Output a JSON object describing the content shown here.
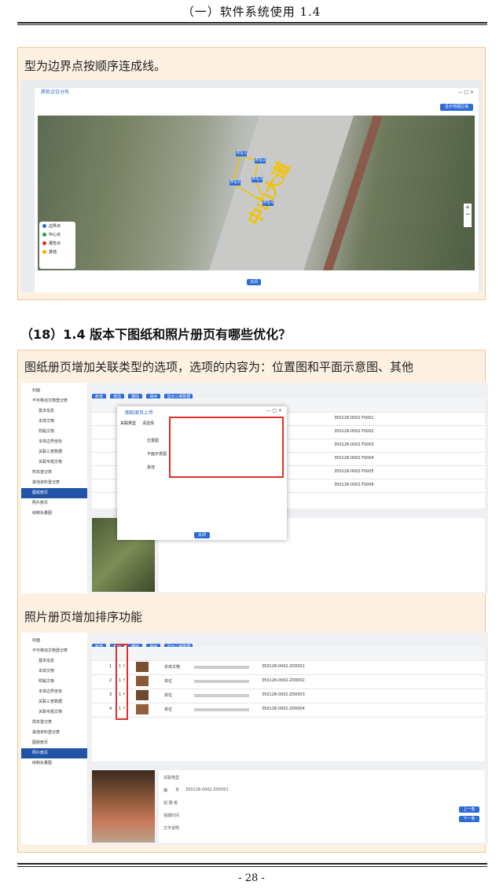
{
  "header": {
    "title": "（一）软件系统使用 1.4"
  },
  "panel1": {
    "text": "型为边界点按顺序连成线。",
    "dialog_title": "质检点位分布",
    "draw_button": "显示地图区域",
    "confirm_button": "关闭",
    "road_label": "中山大道",
    "points": [
      "界址1",
      "界址2",
      "界址3",
      "界址4",
      "界址5"
    ],
    "legend": [
      {
        "label": "边界点",
        "color": "#2d6bd6"
      },
      {
        "label": "中心点",
        "color": "#22a34a"
      },
      {
        "label": "报告点",
        "color": "#e0302a"
      },
      {
        "label": "其他",
        "color": "#e8b400"
      }
    ]
  },
  "section18": {
    "heading": "（18）1.4 版本下图纸和照片册页有哪些优化？"
  },
  "panel2": {
    "text": "图纸册页增加关联类型的选项，选项的内容为：位置图和平面示意图、其他",
    "toolbar": [
      "新增",
      "修改",
      "删除",
      "保存",
      "显示三维数据"
    ],
    "sidebar": [
      "封面",
      "不可移动文物登记表",
      "基本信息",
      "本体文物",
      "附属文物",
      "本体边界坐标",
      "关联三普数据",
      "关联专题文物",
      "附本登记表",
      "其他资料登记表",
      "图纸册页",
      "照片册页",
      "绘制矢量图"
    ],
    "dialog": {
      "title": "图纸册页上传",
      "field_label": "关联类型",
      "select_placeholder": "请选择",
      "options": [
        "位置图",
        "平面示意图",
        "其他"
      ],
      "close_button": "关闭"
    },
    "codes": [
      "350128-0002-T0001",
      "350128-0002-T0002",
      "350128-0002-T0003",
      "350128-0002-T0004",
      "350128-0002-T0005",
      "350128-0002-T0006"
    ]
  },
  "panel2b": {
    "text": "照片册页增加排序功能",
    "toolbar": [
      "新增",
      "修改",
      "删除",
      "保存",
      "显示三维数据"
    ],
    "sidebar": [
      "封面",
      "不可移动文物登记表",
      "基本信息",
      "本体文物",
      "附属文物",
      "本体边界坐标",
      "关联三普数据",
      "关联专题文物",
      "附本登记表",
      "其他资料登记表",
      "图纸册页",
      "照片册页",
      "绘制矢量图"
    ],
    "rows": [
      {
        "no": "1",
        "order": "1 ↑",
        "type": "本体文物",
        "code": "350128-0002-Z00001"
      },
      {
        "no": "2",
        "order": "1 ↑",
        "type": "单位",
        "code": "350128-0002-Z00002"
      },
      {
        "no": "3",
        "order": "1 ↑",
        "type": "单位",
        "code": "350128-0002-Z00003"
      },
      {
        "no": "4",
        "order": "1 ↑",
        "type": "单位",
        "code": "350128-0002-Z00004"
      }
    ],
    "detail_labels": [
      "关联类型",
      "编　　号",
      "拍 摄 者",
      "拍摄时间",
      "文字说明"
    ],
    "detail_value": "350128-0002-Z00001",
    "prev_button": "上一条",
    "next_button": "下一条"
  },
  "footer": {
    "page": "- 28 -"
  }
}
